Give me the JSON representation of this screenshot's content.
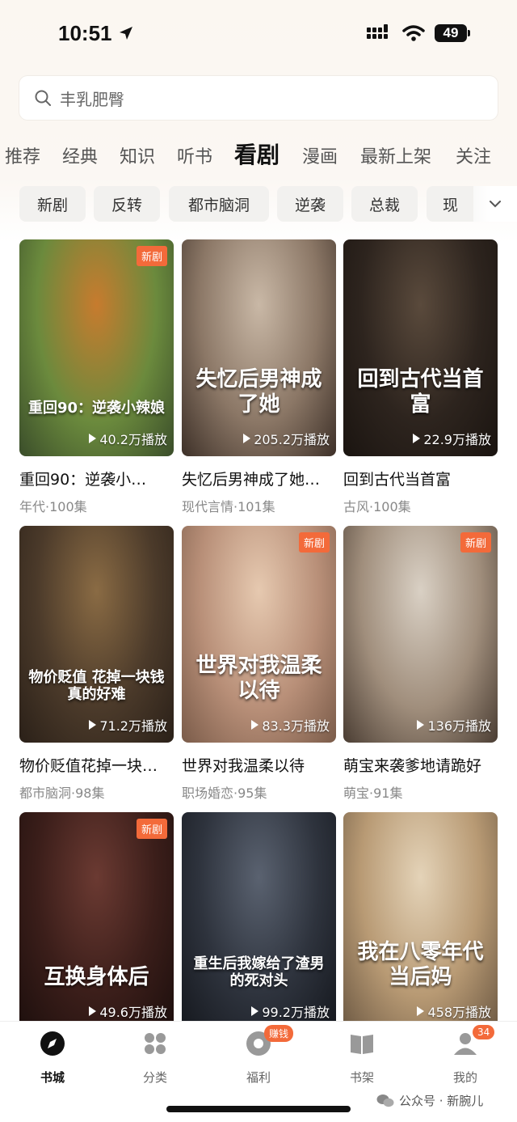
{
  "status": {
    "time": "10:51",
    "battery": "49"
  },
  "search": {
    "placeholder": "丰乳肥臀"
  },
  "tabs": [
    {
      "label": "推荐",
      "active": false
    },
    {
      "label": "经典",
      "active": false
    },
    {
      "label": "知识",
      "active": false
    },
    {
      "label": "听书",
      "active": false
    },
    {
      "label": "看剧",
      "active": true
    },
    {
      "label": "漫画",
      "active": false
    },
    {
      "label": "最新上架",
      "active": false
    },
    {
      "label": "关注",
      "active": false
    }
  ],
  "chips": [
    "新剧",
    "反转",
    "都市脑洞",
    "逆袭",
    "总裁",
    "现"
  ],
  "cards": [
    {
      "title": "重回90：逆袭小…",
      "meta": "年代·100集",
      "plays": "40.2万播放",
      "badge": "新剧",
      "cover_text": "重回90：逆袭小辣娘",
      "colors": [
        "#c77b2e",
        "#6b8a3d",
        "#3a4d2a"
      ]
    },
    {
      "title": "失忆后男神成了她…",
      "meta": "现代言情·101集",
      "plays": "205.2万播放",
      "badge": "",
      "cover_text": "失忆后男神成了她",
      "colors": [
        "#c9b8a6",
        "#8b7766",
        "#3d3028"
      ]
    },
    {
      "title": "回到古代当首富",
      "meta": "古风·100集",
      "plays": "22.9万播放",
      "badge": "",
      "cover_text": "回到古代当首富",
      "colors": [
        "#5a4a3c",
        "#2d241e",
        "#1a1410"
      ]
    },
    {
      "title": "物价贬值花掉一块…",
      "meta": "都市脑洞·98集",
      "plays": "71.2万播放",
      "badge": "",
      "cover_text": "物价贬值 花掉一块钱真的好难",
      "colors": [
        "#8a6b44",
        "#4b3a2a",
        "#2a2018"
      ]
    },
    {
      "title": "世界对我温柔以待",
      "meta": "职场婚恋·95集",
      "plays": "83.3万播放",
      "badge": "新剧",
      "cover_text": "世界对我温柔以待",
      "colors": [
        "#e6c9b0",
        "#b88f78",
        "#7a5b49"
      ]
    },
    {
      "title": "萌宝来袭爹地请跪好",
      "meta": "萌宝·91集",
      "plays": "136万播放",
      "badge": "新剧",
      "cover_text": "",
      "colors": [
        "#d9d0c4",
        "#a08e7c",
        "#4a3d33"
      ]
    },
    {
      "title": "",
      "meta": "",
      "plays": "49.6万播放",
      "badge": "新剧",
      "cover_text": "互换身体后",
      "colors": [
        "#6b3a32",
        "#3b1e1a",
        "#1d0f0d"
      ]
    },
    {
      "title": "",
      "meta": "",
      "plays": "99.2万播放",
      "badge": "",
      "cover_text": "重生后我嫁给了渣男的死对头",
      "colors": [
        "#5a6270",
        "#2e333d",
        "#15181e"
      ]
    },
    {
      "title": "",
      "meta": "",
      "plays": "458万播放",
      "badge": "",
      "cover_text": "我在八零年代当后妈",
      "colors": [
        "#e4d3b8",
        "#b89a74",
        "#6e5a44"
      ]
    }
  ],
  "bottom_nav": [
    {
      "label": "书城",
      "icon": "compass-icon",
      "active": true,
      "badge": ""
    },
    {
      "label": "分类",
      "icon": "grid-icon",
      "active": false,
      "badge": ""
    },
    {
      "label": "福利",
      "icon": "gift-icon",
      "active": false,
      "badge": "赚钱"
    },
    {
      "label": "书架",
      "icon": "book-icon",
      "active": false,
      "badge": ""
    },
    {
      "label": "我的",
      "icon": "person-icon",
      "active": false,
      "badge": "34"
    }
  ],
  "watermark": "公众号 · 新腕儿",
  "colors": {
    "accent": "#f36a3a",
    "chip_bg": "#f2f1ef",
    "text_primary": "#111111",
    "text_secondary": "#888888"
  }
}
